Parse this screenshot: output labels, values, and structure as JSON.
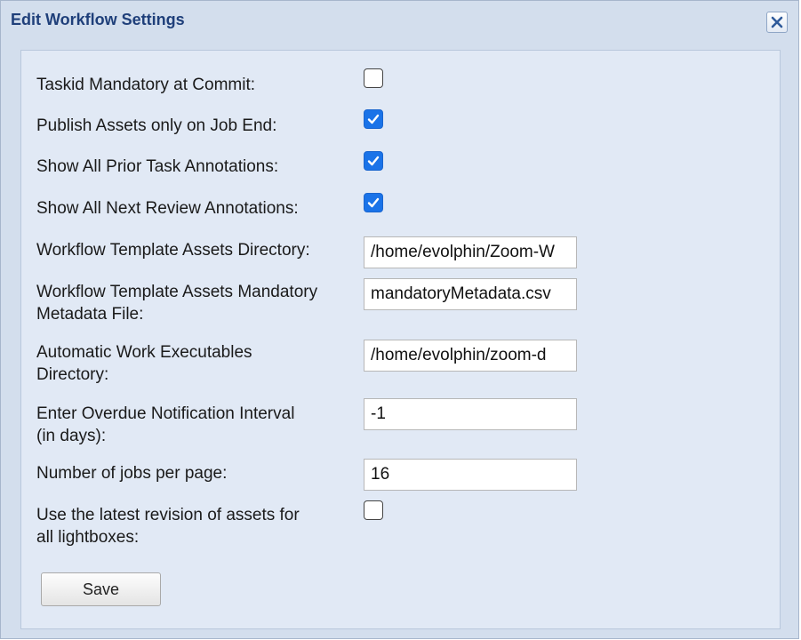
{
  "dialog": {
    "title": "Edit Workflow Settings"
  },
  "settings": {
    "taskid_mandatory": {
      "label": "Taskid Mandatory at Commit:",
      "checked": false
    },
    "publish_assets_on_job_end": {
      "label": "Publish Assets only on Job End:",
      "checked": true
    },
    "show_prior_task_annotations": {
      "label": "Show All Prior Task Annotations:",
      "checked": true
    },
    "show_next_review_annotations": {
      "label": "Show All Next Review Annotations:",
      "checked": true
    },
    "template_assets_directory": {
      "label": "Workflow Template Assets Directory:",
      "value": "/home/evolphin/Zoom-W"
    },
    "template_assets_mandatory_metadata": {
      "label_line1": "Workflow Template Assets Mandatory",
      "label_line2": "Metadata File:",
      "value": "mandatoryMetadata.csv"
    },
    "automatic_work_executables": {
      "label_line1": "Automatic Work Executables",
      "label_line2": "Directory:",
      "value": "/home/evolphin/zoom-d"
    },
    "overdue_notification_interval": {
      "label_line1": "Enter Overdue Notification Interval",
      "label_line2": "(in days):",
      "value": "-1"
    },
    "jobs_per_page": {
      "label": "Number of jobs per page:",
      "value": "16"
    },
    "latest_revision_lightboxes": {
      "label_line1": "Use the latest revision of assets for",
      "label_line2": "all lightboxes:",
      "checked": false
    }
  },
  "actions": {
    "save_label": "Save"
  },
  "colors": {
    "dialog_bg": "#d3deed",
    "content_bg": "#e1e9f5",
    "title_text": "#1f3f7a",
    "checkbox_checked": "#1a73e8"
  }
}
